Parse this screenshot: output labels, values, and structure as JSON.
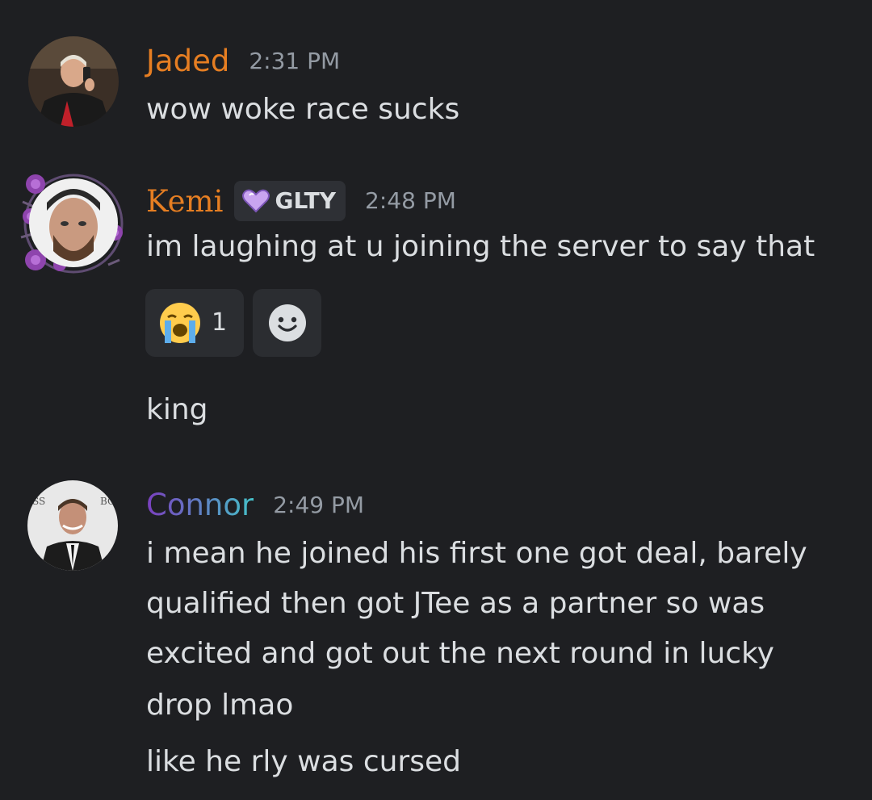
{
  "messages": [
    {
      "author": "Jaded",
      "author_color": "#e67e22",
      "time": "2:31 PM",
      "lines": [
        "wow woke race sucks"
      ]
    },
    {
      "author": "Kemi",
      "author_color": "#e67e22",
      "tag": {
        "icon": "heart-icon",
        "label": "GLTY"
      },
      "time": "2:48 PM",
      "lines": [
        "im laughing at u joining the server to say that"
      ],
      "reactions": [
        {
          "emoji": "loudly-crying-face-icon",
          "count": "1"
        }
      ],
      "add_reaction_icon": "add-reaction-smiley-icon",
      "followup": [
        "king"
      ]
    },
    {
      "author": "Connor",
      "author_gradient": [
        "#7b3fbf",
        "#45c0c8"
      ],
      "time": "2:49 PM",
      "lines": [
        "i mean he joined his first one got deal, barely",
        "qualified then got JTee as a partner so was",
        "excited and got out the next round in lucky",
        "drop lmao"
      ],
      "followup": [
        "like he rly was cursed"
      ]
    }
  ]
}
